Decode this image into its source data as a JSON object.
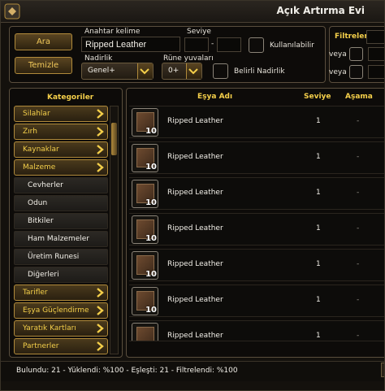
{
  "window": {
    "title": "Açık Artırma Evi"
  },
  "search": {
    "search_button": "Ara",
    "clear_button": "Temizle",
    "keyword_label": "Anahtar kelime",
    "keyword_value": "Ripped Leather",
    "level_label": "Seviye",
    "level_separator": "-",
    "usable_label": "Kullanılabilir",
    "rarity_label": "Nadirlik",
    "rarity_value": "Genel+",
    "rune_label": "Rüne yuvaları",
    "rune_value": "0+",
    "specific_rarity_label": "Belirli Nadirlik"
  },
  "filters": {
    "title": "Filtreler",
    "or1": "veya",
    "or2": "veya"
  },
  "categories": {
    "title": "Kategoriler",
    "items": [
      {
        "label": "Silahlar",
        "type": "parent"
      },
      {
        "label": "Zırh",
        "type": "parent"
      },
      {
        "label": "Kaynaklar",
        "type": "parent"
      },
      {
        "label": "Malzeme",
        "type": "parent"
      },
      {
        "label": "Cevherler",
        "type": "child"
      },
      {
        "label": "Odun",
        "type": "child"
      },
      {
        "label": "Bitkiler",
        "type": "child"
      },
      {
        "label": "Ham Malzemeler",
        "type": "child"
      },
      {
        "label": "Üretim Runesi",
        "type": "child"
      },
      {
        "label": "Diğerleri",
        "type": "child"
      },
      {
        "label": "Tarifler",
        "type": "parent"
      },
      {
        "label": "Eşya Güçlendirme",
        "type": "parent"
      },
      {
        "label": "Yaratık Kartları",
        "type": "parent"
      },
      {
        "label": "Partnerler",
        "type": "parent"
      }
    ]
  },
  "results": {
    "columns": {
      "name": "Eşya Adı",
      "level": "Seviye",
      "stage": "Aşama"
    },
    "rows": [
      {
        "name": "Ripped Leather",
        "qty": "10",
        "level": "1",
        "stage": "-"
      },
      {
        "name": "Ripped Leather",
        "qty": "10",
        "level": "1",
        "stage": "-"
      },
      {
        "name": "Ripped Leather",
        "qty": "10",
        "level": "1",
        "stage": "-"
      },
      {
        "name": "Ripped Leather",
        "qty": "10",
        "level": "1",
        "stage": "-"
      },
      {
        "name": "Ripped Leather",
        "qty": "10",
        "level": "1",
        "stage": "-"
      },
      {
        "name": "Ripped Leather",
        "qty": "10",
        "level": "1",
        "stage": "-"
      },
      {
        "name": "Ripped Leather",
        "qty": "",
        "level": "1",
        "stage": "-"
      }
    ]
  },
  "status": {
    "text": "Bulundu: 21 - Yüklendi: %100 - Eşleşti: 21 - Filtrelendi: %100"
  },
  "colors": {
    "accent": "#f4cf4a",
    "border": "#b08a3b"
  }
}
